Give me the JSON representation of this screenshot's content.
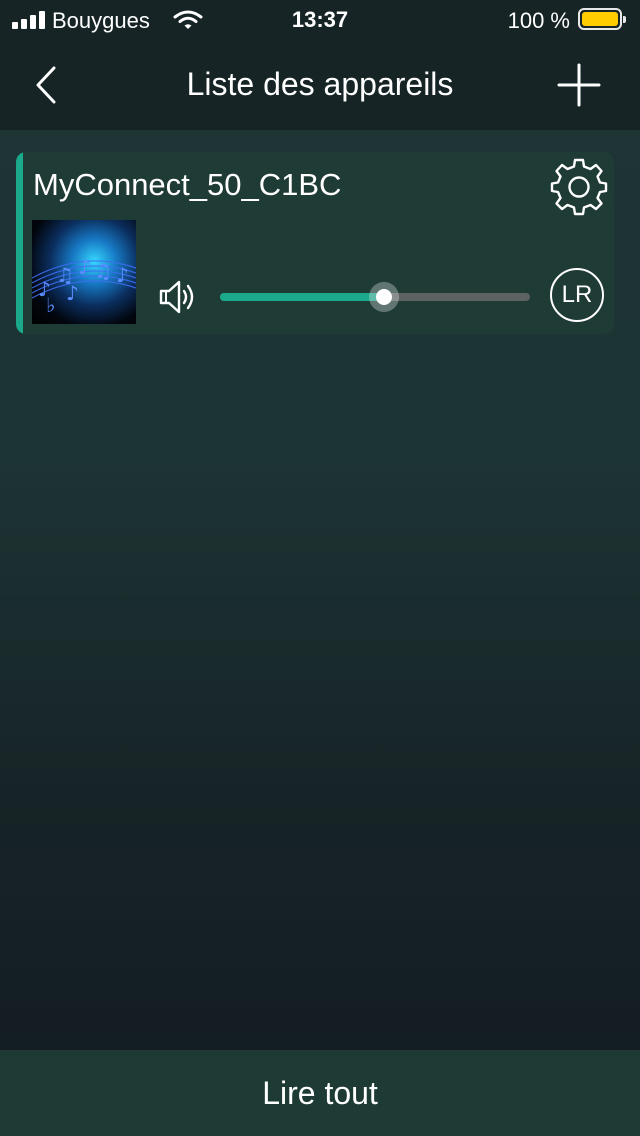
{
  "status_bar": {
    "carrier": "Bouygues",
    "time": "13:37",
    "battery": "100 %",
    "battery_color": "#ffcc00"
  },
  "nav": {
    "title": "Liste des appareils",
    "back_icon": "chevron-left-icon",
    "add_icon": "plus-icon"
  },
  "device": {
    "name": "MyConnect_50_C1BC",
    "settings_icon": "gear-icon",
    "volume_icon": "speaker-icon",
    "volume_level": 0.53,
    "channel_label": "LR"
  },
  "footer": {
    "play_all_label": "Lire tout"
  },
  "colors": {
    "accent": "#1aa98a",
    "card_bg": "#1f3b36",
    "header_bg": "#162426"
  }
}
